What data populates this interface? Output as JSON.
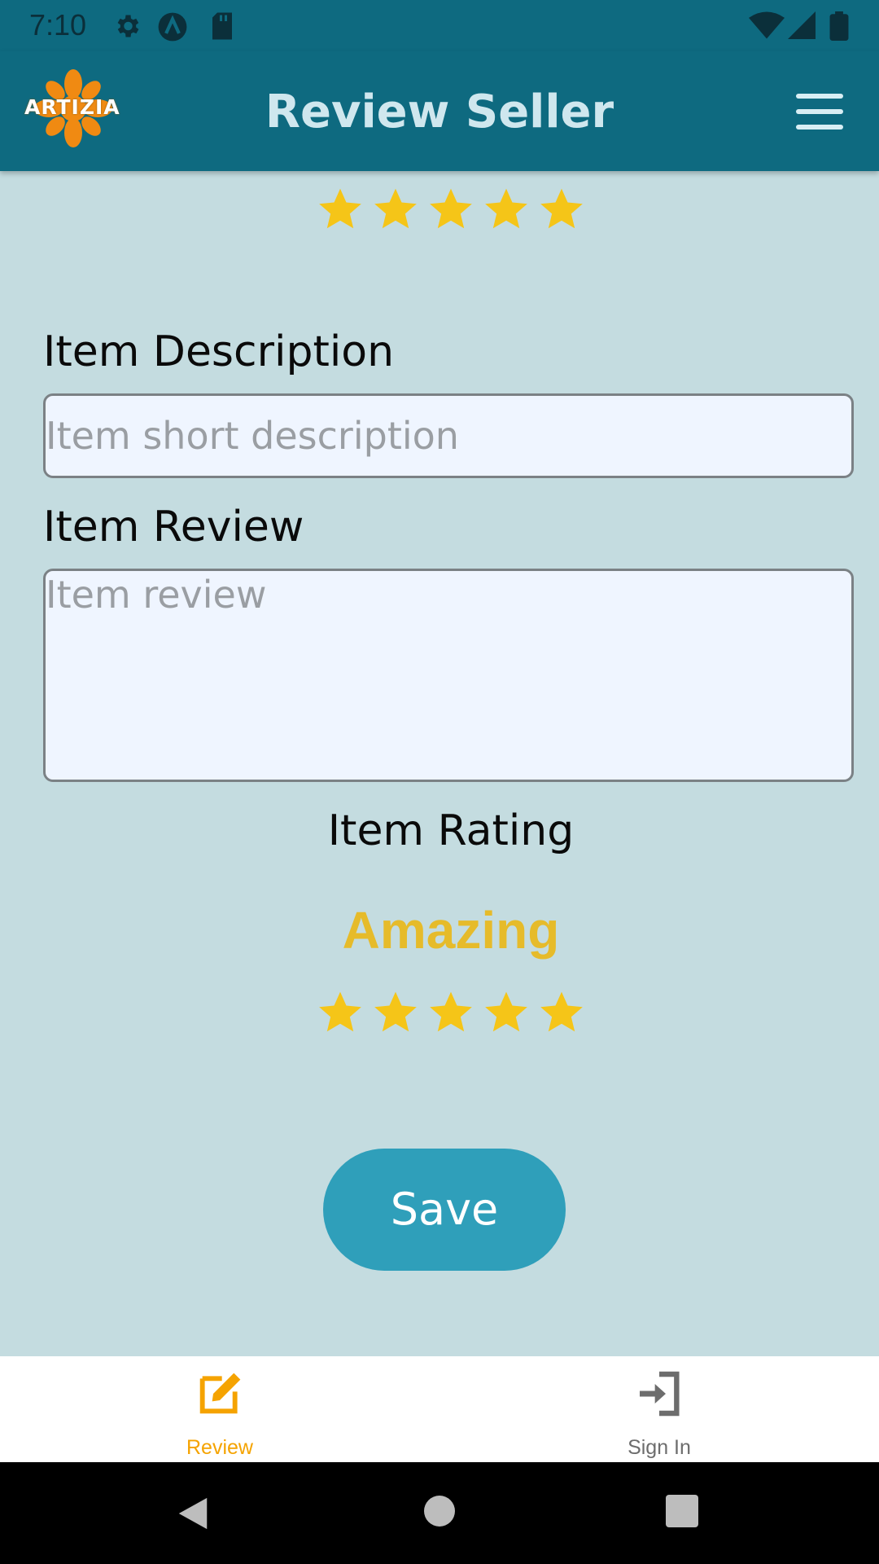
{
  "status_bar": {
    "time": "7:10",
    "icons": [
      "settings-icon",
      "app-a-icon",
      "sd-card-icon",
      "wifi-icon",
      "signal-icon",
      "battery-icon"
    ]
  },
  "app_bar": {
    "logo_text": "ARTIZIA",
    "title": "Review Seller",
    "menu_icon": "hamburger-menu-icon"
  },
  "top_rating": {
    "stars_filled": 5,
    "stars_total": 5
  },
  "form": {
    "description_label": "Item Description",
    "description_placeholder": "Item short description",
    "description_value": "",
    "review_label": "Item Review",
    "review_placeholder": "Item review",
    "review_value": "",
    "rating_label": "Item Rating",
    "rating_word": "Amazing",
    "rating_stars_filled": 5,
    "rating_stars_total": 5,
    "save_label": "Save"
  },
  "bottom_nav": {
    "items": [
      {
        "label": "Review",
        "icon": "edit-icon",
        "active": true
      },
      {
        "label": "Sign In",
        "icon": "sign-in-icon",
        "active": false
      }
    ]
  },
  "colors": {
    "app_bar": "#0e6a80",
    "background": "#c4dce0",
    "star": "#f5c518",
    "rating_word": "#e6bb2a",
    "save_button": "#2f9fba",
    "nav_active": "#f5a300",
    "nav_inactive": "#6d6d6d"
  }
}
